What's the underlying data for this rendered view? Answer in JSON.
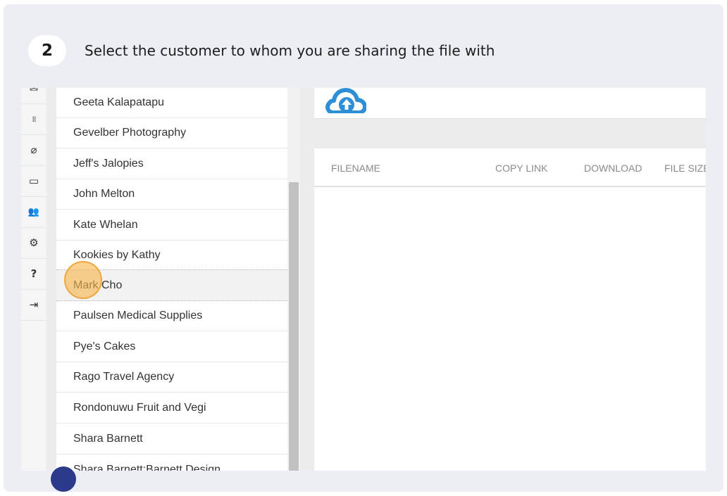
{
  "step": {
    "number": "2",
    "instruction": "Select the customer to whom you are sharing the file with"
  },
  "rail": {
    "icons": [
      "inbox-icon",
      "grid-icon",
      "search-icon",
      "card-icon",
      "users-icon",
      "gear-icon",
      "help-icon",
      "logout-icon"
    ],
    "glyphs": [
      "✉",
      "⁞⁞",
      "⌀",
      "▭",
      "👥",
      "⚙",
      "?",
      "⇥"
    ]
  },
  "customers": [
    "Geeta Kalapatapu",
    "Gevelber Photography",
    "Jeff's Jalopies",
    "John Melton",
    "Kate Whelan",
    "Kookies by Kathy",
    "Mark Cho",
    "Paulsen Medical Supplies",
    "Pye's Cakes",
    "Rago Travel Agency",
    "Rondonuwu Fruit and Vegi",
    "Shara Barnett",
    "Shara Barnett:Barnett Design"
  ],
  "selected_customer": "Mark Cho",
  "table": {
    "columns": [
      "FILENAME",
      "COPY LINK",
      "DOWNLOAD",
      "FILE SIZE"
    ]
  },
  "colors": {
    "accent": "#2e8fd6",
    "cursor": "#f8b44c"
  }
}
